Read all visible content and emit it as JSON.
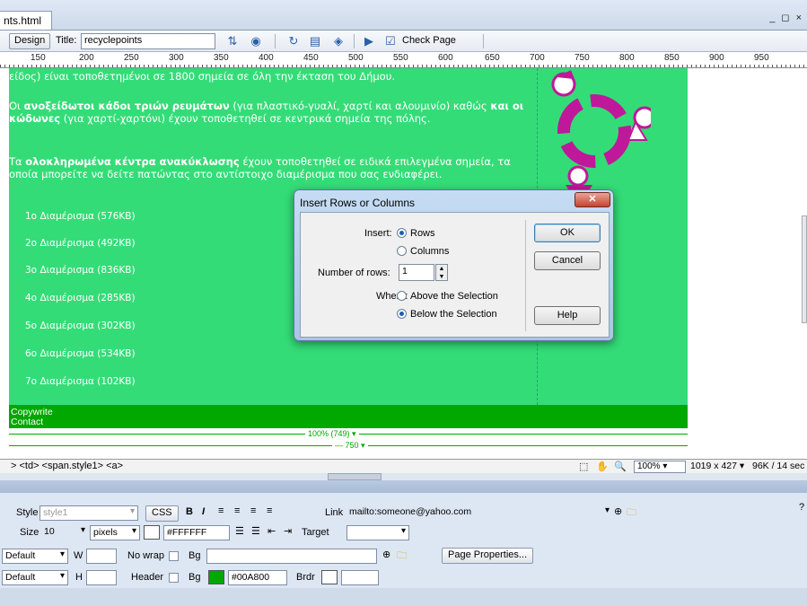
{
  "document_tab": {
    "filename": "nts.html",
    "window_controls": "_ ◻ ×"
  },
  "toolbar": {
    "design_label": "Design",
    "title_label": "Title:",
    "title_value": "recyclepoints",
    "check_page_label": "Check Page"
  },
  "ruler": {
    "ticks": [
      "150",
      "200",
      "250",
      "300",
      "350",
      "400",
      "450",
      "500",
      "550",
      "600",
      "650",
      "700",
      "750",
      "800",
      "850",
      "900",
      "950"
    ]
  },
  "page": {
    "para0": "είδος) είναι τοποθετημένοι σε 1800 σημεία σε όλη την έκταση του Δήμου.",
    "para1_pre": "Οι ",
    "para1_b1": "ανοξείδωτοι κάδοι τριών ρευμάτων",
    "para1_mid1": " (για πλαστικό-γυαλί, χαρτί και αλουμινίο) καθώς ",
    "para1_b2": "και οι κώδωνες",
    "para1_post": " (για χαρτί-χαρτόνι) έχουν τοποθετηθεί σε κεντρικά σημεία της πόλης.",
    "para2_pre": "Τα ",
    "para2_b": "ολοκληρωμένα κέντρα ανακύκλωσης",
    "para2_post": " έχουν τοποθετηθεί σε ειδικά επιλεγμένα σημεία, τα οποία μπορείτε να δείτε πατώντας στο αντίστοιχο διαμέρισμα που σας ενδιαφέρει.",
    "links": [
      "1ο Διαμέρισμα (576KB)",
      "2ο Διαμέρισμα (492KB)",
      "3ο Διαμέρισμα (836KB)",
      "4ο Διαμέρισμα (285KB)",
      "5ο Διαμέρισμα (302KB)",
      "6ο Διαμέρισμα (534KB)",
      "7ο Διαμέρισμα (102KB)"
    ],
    "footer_line1": "Copywrite",
    "footer_line2": "Contact",
    "width_label1": "100% (749)",
    "width_label2": "750"
  },
  "status": {
    "tag_selector": "> <td> <span.style1> <a>",
    "zoom": "100%",
    "window_size": "1019 x 427",
    "download": "96K / 14 sec"
  },
  "properties": {
    "style_label": "Style",
    "style_value": "style1",
    "css_button": "CSS",
    "bold": "B",
    "italic": "I",
    "link_label": "Link",
    "link_value": "mailto:someone@yahoo.com",
    "size_label": "Size",
    "size_value": "10",
    "unit_value": "pixels",
    "text_color": "#FFFFFF",
    "target_label": "Target",
    "horz_value": "Default",
    "w_label": "W",
    "nowrap_label": "No wrap",
    "bg_label": "Bg",
    "page_props_button": "Page Properties...",
    "vert_value": "Default",
    "h_label": "H",
    "header_label": "Header",
    "bg_color": "#00A800",
    "brdr_label": "Brdr"
  },
  "dialog": {
    "title": "Insert Rows or Columns",
    "insert_label": "Insert:",
    "opt_rows": "Rows",
    "opt_columns": "Columns",
    "num_rows_label": "Number of rows:",
    "num_rows_value": "1",
    "where_label": "Where:",
    "opt_above": "Above the Selection",
    "opt_below": "Below the Selection",
    "ok": "OK",
    "cancel": "Cancel",
    "help": "Help"
  },
  "colors": {
    "page_bg": "#34DC77",
    "footer_bg": "#00A800",
    "accent_magenta": "#C0189A"
  }
}
